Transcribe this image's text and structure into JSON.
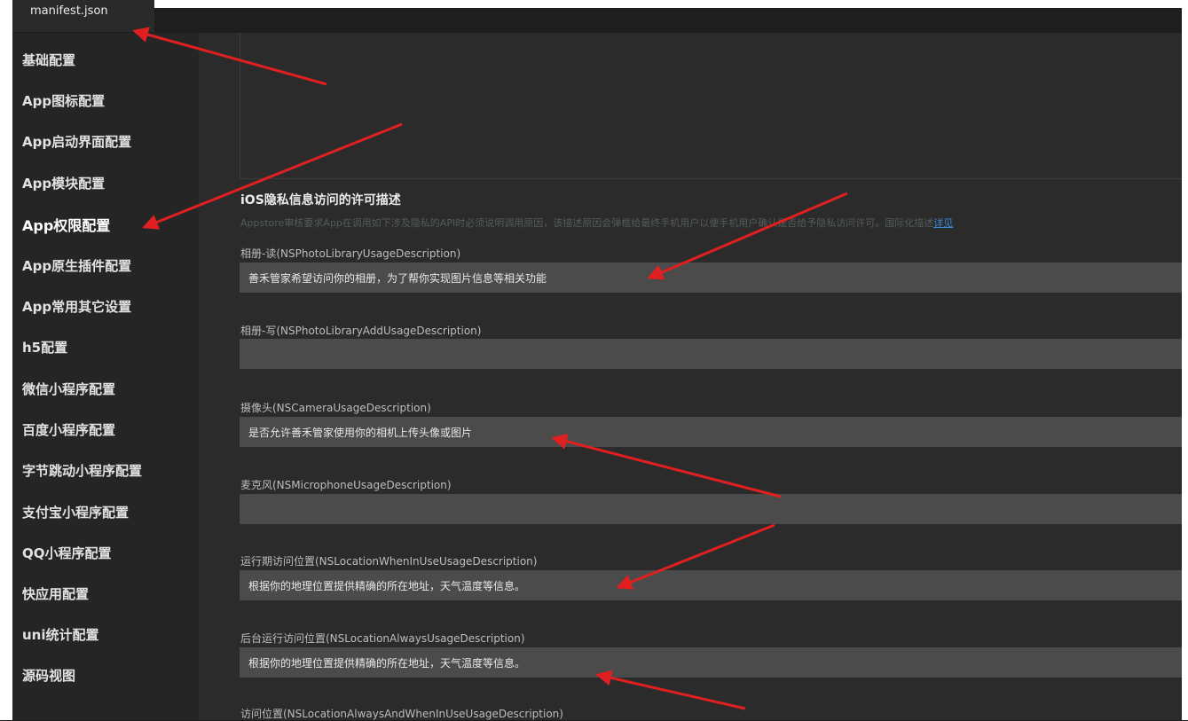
{
  "tab": {
    "label": "manifest.json"
  },
  "sidebar": {
    "items": [
      {
        "label": "基础配置"
      },
      {
        "label": "App图标配置"
      },
      {
        "label": "App启动界面配置"
      },
      {
        "label": "App模块配置"
      },
      {
        "label": "App权限配置"
      },
      {
        "label": "App原生插件配置"
      },
      {
        "label": "App常用其它设置"
      },
      {
        "label": "h5配置"
      },
      {
        "label": "微信小程序配置"
      },
      {
        "label": "百度小程序配置"
      },
      {
        "label": "字节跳动小程序配置"
      },
      {
        "label": "支付宝小程序配置"
      },
      {
        "label": "QQ小程序配置"
      },
      {
        "label": "快应用配置"
      },
      {
        "label": "uni统计配置"
      },
      {
        "label": "源码视图"
      }
    ]
  },
  "section": {
    "title": "iOS隐私信息访问的许可描述",
    "description": "Appstore审核要求App在调用如下涉及隐私的API时必须说明调用原因，该描述原因会弹框给最终手机用户以便手机用户确认是否给予隐私访问许可。国际化描述",
    "link": "详见"
  },
  "fields": [
    {
      "label": "相册-读(NSPhotoLibraryUsageDescription)",
      "value": "善禾管家希望访问你的相册，为了帮你实现图片信息等相关功能"
    },
    {
      "label": "相册-写(NSPhotoLibraryAddUsageDescription)",
      "value": ""
    },
    {
      "label": "摄像头(NSCameraUsageDescription)",
      "value": "是否允许善禾管家使用你的相机上传头像或图片"
    },
    {
      "label": "麦克风(NSMicrophoneUsageDescription)",
      "value": ""
    },
    {
      "label": "运行期访问位置(NSLocationWhenInUseUsageDescription)",
      "value": "根据你的地理位置提供精确的所在地址，天气温度等信息。"
    },
    {
      "label": "后台运行访问位置(NSLocationAlwaysUsageDescription)",
      "value": "根据你的地理位置提供精确的所在地址，天气温度等信息。"
    },
    {
      "label": "访问位置(NSLocationAlwaysAndWhenInUseUsageDescription)",
      "value": ""
    }
  ],
  "annotation_color": "#e02020"
}
